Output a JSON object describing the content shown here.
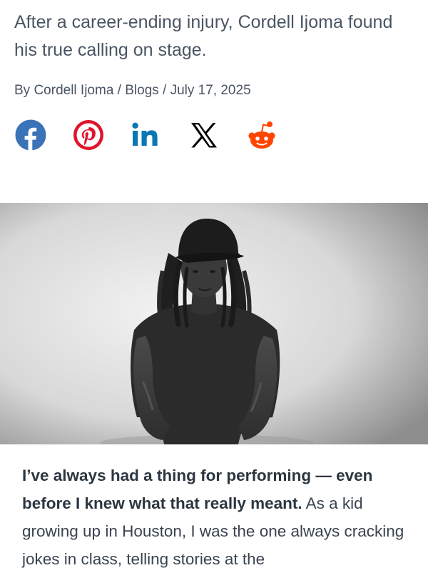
{
  "article": {
    "subtitle": "After a career-ending injury, Cordell Ijoma found his true calling on stage.",
    "byline": {
      "prefix": "By ",
      "author": "Cordell Ijoma",
      "separator_1": " / ",
      "category": "Blogs",
      "separator_2": " / ",
      "date": "July 17, 2025"
    },
    "share": [
      {
        "network": "Facebook",
        "icon": "facebook-icon",
        "color": "#3b73b9"
      },
      {
        "network": "Pinterest",
        "icon": "pinterest-icon",
        "color": "#e0142b"
      },
      {
        "network": "LinkedIn",
        "icon": "linkedin-icon",
        "color": "#0a77b5"
      },
      {
        "network": "X",
        "icon": "x-icon",
        "color": "#000000"
      },
      {
        "network": "Reddit",
        "icon": "reddit-icon",
        "color": "#ff4500"
      }
    ],
    "hero_image": {
      "description": "black and white portrait photo"
    },
    "body": {
      "lead_bold": "I’ve always had a thing for performing — even before I knew what that really meant.",
      "text": " As a kid growing up in Houston, I was the one always cracking jokes in class, telling stories at the"
    }
  }
}
